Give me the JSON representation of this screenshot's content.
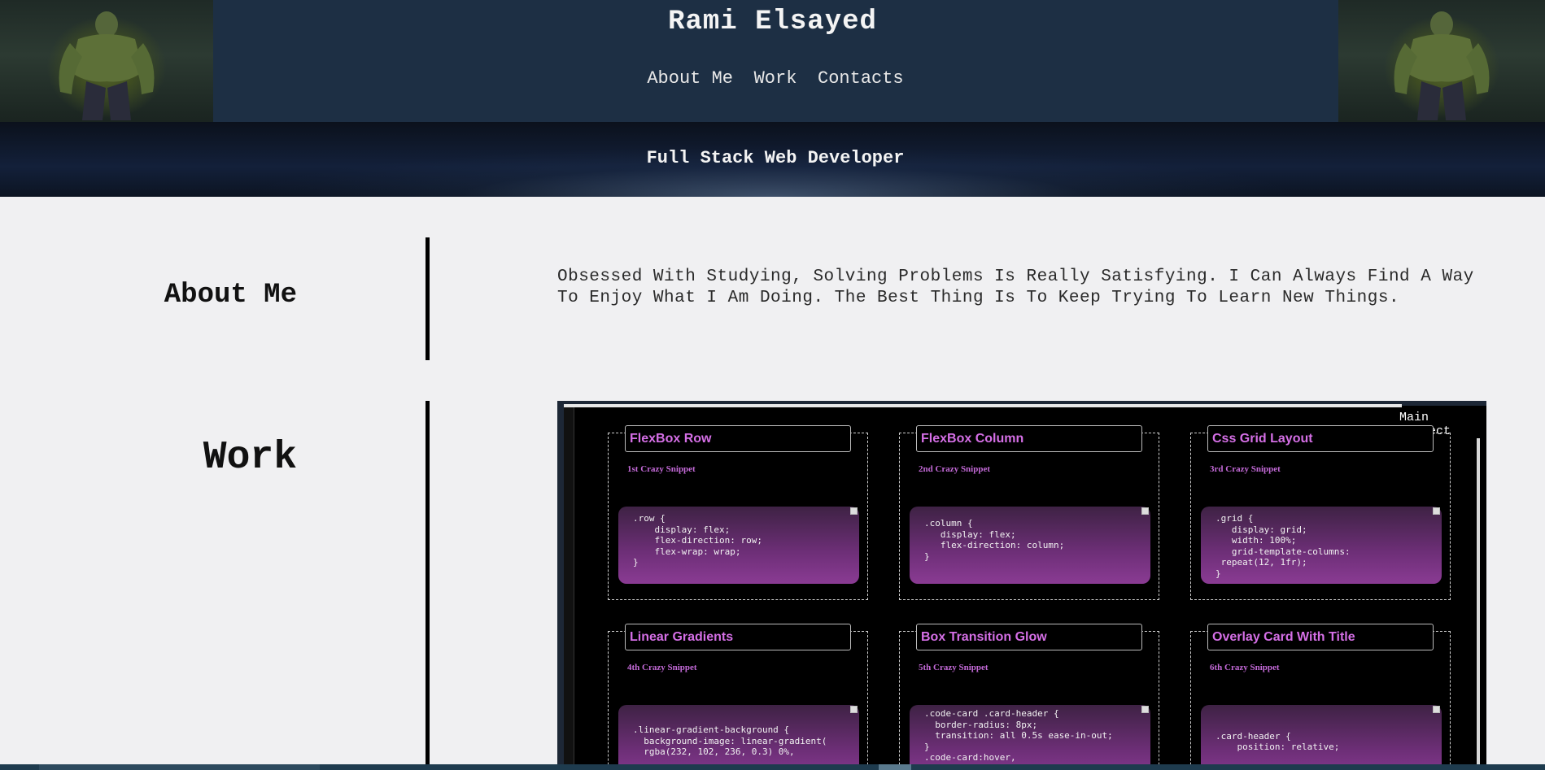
{
  "header": {
    "title": "Rami Elsayed",
    "nav": [
      {
        "label": "About Me"
      },
      {
        "label": "Work"
      },
      {
        "label": "Contacts"
      }
    ]
  },
  "banner": {
    "text": "Full Stack Web Developer"
  },
  "about": {
    "heading": "About Me",
    "text": "Obsessed With Studying, Solving Problems Is Really Satisfying. I Can Always Find A Way To Enjoy What I Am Doing. The Best Thing Is To Keep Trying To Learn New Things."
  },
  "work": {
    "heading": "Work",
    "preview_label": "Main Project",
    "cards": [
      {
        "title": "FlexBox Row",
        "subtitle": "1st Crazy Snippet",
        "code": ".row {\n    display: flex;\n    flex-direction: row;\n    flex-wrap: wrap;\n}"
      },
      {
        "title": "FlexBox Column",
        "subtitle": "2nd Crazy Snippet",
        "code": ".column {\n   display: flex;\n   flex-direction: column;\n}"
      },
      {
        "title": "Css Grid Layout",
        "subtitle": "3rd Crazy Snippet",
        "code": ".grid {\n   display: grid;\n   width: 100%;\n   grid-template-columns:\n repeat(12, 1fr);\n}"
      },
      {
        "title": "Linear Gradients",
        "subtitle": "4th Crazy Snippet",
        "code": ".linear-gradient-background {\n  background-image: linear-gradient(\n  rgba(232, 102, 236, 0.3) 0%,"
      },
      {
        "title": "Box Transition Glow",
        "subtitle": "5th Crazy Snippet",
        "code": ".code-card .card-header {\n  border-radius: 8px;\n  transition: all 0.5s ease-in-out;\n}\n.code-card:hover,"
      },
      {
        "title": "Overlay Card With Title",
        "subtitle": "6th Crazy Snippet",
        "code": "\n.card-header {\n    position: relative;"
      }
    ]
  },
  "colors": {
    "header_bg": "#1d2f44",
    "page_bg": "#f0f0f2",
    "card_title": "#d56fe6",
    "code_box": "#6e2f78"
  }
}
